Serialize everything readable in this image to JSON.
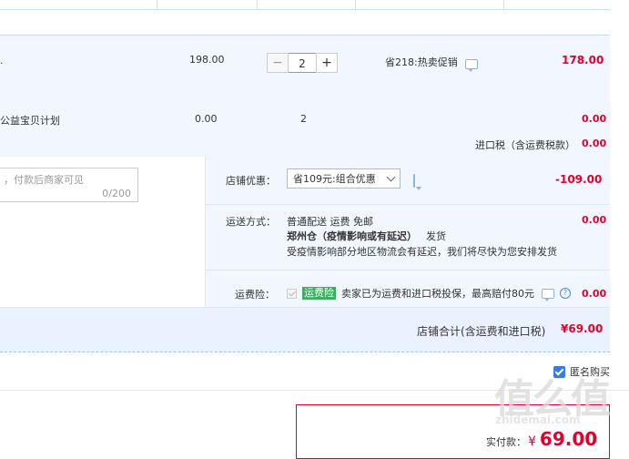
{
  "items": [
    {
      "title_fragment": ".",
      "unit_price": "198.00",
      "quantity": "2",
      "promo": "省218:热卖促销",
      "subtotal": "178.00"
    },
    {
      "title_fragment": "公益宝贝计划",
      "unit_price": "0.00",
      "quantity": "2",
      "subtotal": "0.00"
    }
  ],
  "import_tax": {
    "label": "进口税（含运费税款）",
    "value": "0.00"
  },
  "message": {
    "placeholder": "，付款后商家可见",
    "counter": "0/200"
  },
  "shop_discount": {
    "label": "店铺优惠：",
    "selected": "省109元:组合优惠",
    "value": "-109.00"
  },
  "shipping": {
    "label": "运送方式：",
    "method": "普通配送 运费 免邮",
    "warehouse": "郑州仓（疫情影响或有延迟）",
    "ship_note": "发货",
    "notice": "受疫情影响部分地区物流会有延迟，我们将尽快为您安排发货",
    "value": "0.00"
  },
  "insurance": {
    "label": "运费险：",
    "badge": "运费险",
    "text": "卖家已为运费和进口税投保，最高赔付80元",
    "help": "?",
    "value": "0.00"
  },
  "shop_total": {
    "label": "店铺合计(含运费和进口税)",
    "value": "¥69.00"
  },
  "anonymous": {
    "label": "匿名购买",
    "checked": true
  },
  "payment": {
    "label": "实付款：",
    "currency": "¥",
    "value": "69.00"
  },
  "watermark": {
    "logo": "值么值",
    "url": "zhidemai.com"
  },
  "colors": {
    "accent_red": "#e4002b",
    "panel_blue": "#f2f7ff",
    "badge_green": "#3cae5d"
  }
}
